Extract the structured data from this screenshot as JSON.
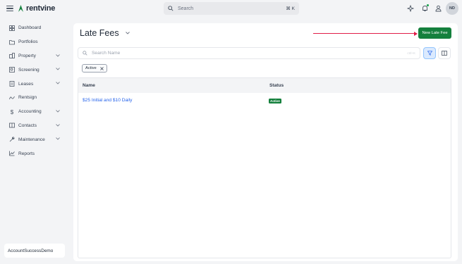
{
  "app": {
    "name": "rentvine"
  },
  "header": {
    "search_placeholder": "Search",
    "search_shortcut": "⌘ K",
    "avatar_initials": "ND"
  },
  "sidebar": {
    "items": [
      {
        "label": "Dashboard",
        "icon": "dashboard-icon",
        "expandable": false
      },
      {
        "label": "Portfolios",
        "icon": "folder-icon",
        "expandable": false
      },
      {
        "label": "Property",
        "icon": "building-icon",
        "expandable": true
      },
      {
        "label": "Screening",
        "icon": "screening-icon",
        "expandable": true
      },
      {
        "label": "Leases",
        "icon": "lease-icon",
        "expandable": true
      },
      {
        "label": "Rentsign",
        "icon": "signature-icon",
        "expandable": false
      },
      {
        "label": "Accounting",
        "icon": "dollar-icon",
        "expandable": true
      },
      {
        "label": "Contacts",
        "icon": "contacts-icon",
        "expandable": true
      },
      {
        "label": "Maintenance",
        "icon": "wrench-icon",
        "expandable": true
      },
      {
        "label": "Reports",
        "icon": "reports-icon",
        "expandable": false
      }
    ],
    "account": "AccountSuccessDemo"
  },
  "main": {
    "title": "Late Fees",
    "new_button": "New Late Fee",
    "search_placeholder": "Search Name",
    "search_shortcut": "ctrl+K",
    "filter_chip": "Active",
    "table": {
      "columns": [
        "Name",
        "Status"
      ],
      "rows": [
        {
          "name": "$25 Initial and $10 Daily",
          "status": "Active"
        }
      ]
    }
  },
  "colors": {
    "brand_green": "#15803d",
    "link_blue": "#2563eb",
    "annotation_red": "#e11d48"
  }
}
